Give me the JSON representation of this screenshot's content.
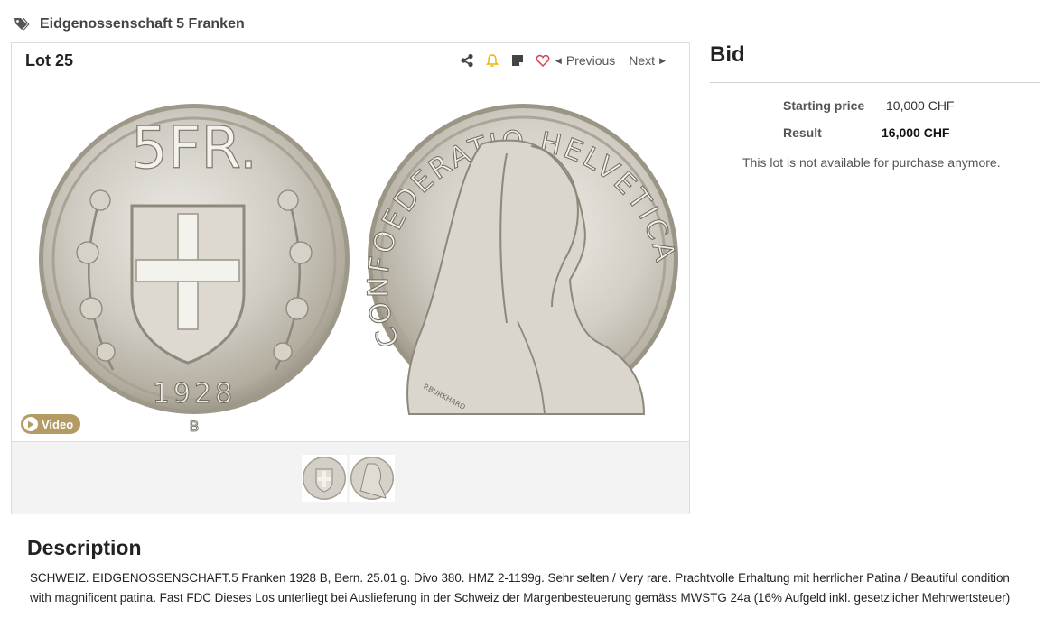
{
  "breadcrumb": {
    "icon": "tags-icon",
    "label": "Eidgenossenschaft 5 Franken"
  },
  "lot": {
    "title": "Lot 25",
    "actions": {
      "share": "share-icon",
      "alert": "bell-icon",
      "note": "note-icon",
      "watch": "heart-icon"
    },
    "prev_label": "Previous",
    "next_label": "Next",
    "video_label": "Video",
    "coin_obverse": {
      "denomination": "5FR.",
      "year": "1928",
      "mint": "B"
    },
    "coin_reverse": {
      "legend": "CONFOEDERATIO HELVETICA",
      "signature": "P.BURKHARD"
    }
  },
  "bid": {
    "title": "Bid",
    "starting_price_label": "Starting price",
    "starting_price_value": "10,000 CHF",
    "result_label": "Result",
    "result_value": "16,000 CHF",
    "note": "This lot is not available for purchase anymore."
  },
  "description": {
    "title": "Description",
    "body": "SCHWEIZ. EIDGENOSSENSCHAFT.5 Franken 1928 B, Bern. 25.01 g. Divo 380. HMZ 2-1199g. Sehr selten / Very rare. Prachtvolle Erhaltung mit herrlicher Patina / Beautiful condition with magnificent patina. Fast FDC Dieses Los unterliegt bei Auslieferung in der Schweiz der Margenbesteuerung gemäss MWSTG 24a (16% Aufgeld inkl. gesetzlicher Mehrwertsteuer)"
  },
  "colors": {
    "accent_gold": "#b49a63",
    "bell": "#f0b400",
    "heart": "#d9434e"
  }
}
